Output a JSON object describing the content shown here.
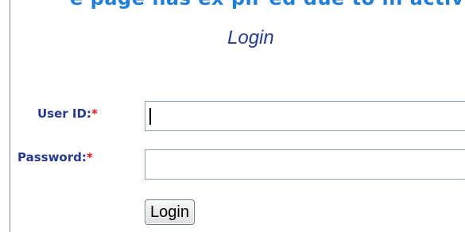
{
  "header": {
    "banner_text": "e page has ex pir ed due to in activity. Log in again."
  },
  "form": {
    "title": "Login",
    "user_id": {
      "label": "User ID:",
      "required_mark": "*",
      "value": "",
      "placeholder": ""
    },
    "password": {
      "label": "Password:",
      "required_mark": "*",
      "value": "",
      "placeholder": ""
    },
    "submit_label": "Login"
  }
}
